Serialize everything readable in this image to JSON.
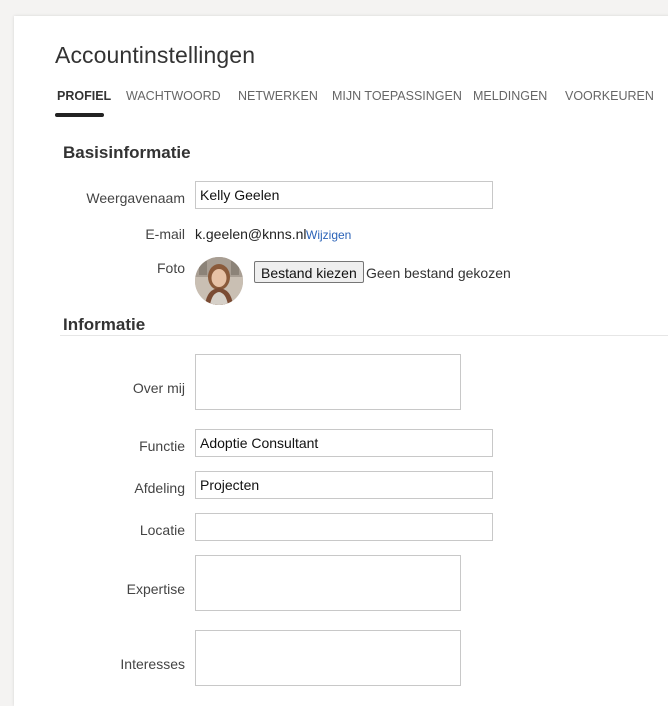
{
  "page": {
    "title": "Accountinstellingen"
  },
  "tabs": [
    {
      "label": "PROFIEL",
      "active": true
    },
    {
      "label": "WACHTWOORD",
      "active": false
    },
    {
      "label": "NETWERKEN",
      "active": false
    },
    {
      "label": "MIJN TOEPASSINGEN",
      "active": false
    },
    {
      "label": "MELDINGEN",
      "active": false
    },
    {
      "label": "VOORKEUREN",
      "active": false
    }
  ],
  "basic": {
    "title": "Basisinformatie",
    "display_name_label": "Weergavenaam",
    "display_name_value": "Kelly Geelen",
    "email_label": "E-mail",
    "email_value": "k.geelen@knns.nl",
    "email_change": "Wijzigen",
    "photo_label": "Foto",
    "file_button": "Bestand kiezen",
    "file_status": "Geen bestand gekozen"
  },
  "info": {
    "title": "Informatie",
    "about_label": "Over mij",
    "about_value": "",
    "function_label": "Functie",
    "function_value": "Adoptie Consultant",
    "department_label": "Afdeling",
    "department_value": "Projecten",
    "location_label": "Locatie",
    "location_value": "",
    "expertise_label": "Expertise",
    "expertise_value": "",
    "interests_label": "Interesses",
    "interests_value": ""
  },
  "colors": {
    "link": "#2b63b8",
    "tab_underline": "#222222"
  }
}
